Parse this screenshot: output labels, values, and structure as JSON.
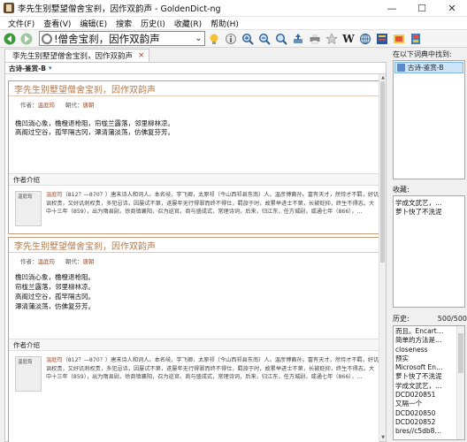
{
  "window": {
    "title": "李先生别墅望僧舍宝刹，因作双韵声 - GoldenDict-ng",
    "minimize": "—",
    "maximize": "☐",
    "close": "✕"
  },
  "menu": [
    "文件(F)",
    "查看(V)",
    "编辑(E)",
    "搜索",
    "历史(I)",
    "收藏(R)",
    "帮助(H)"
  ],
  "toolbar": {
    "search_value": "!僧舍宝刹，因作双韵声",
    "icons": [
      "back-icon",
      "forward-icon",
      "lightbulb-icon",
      "info-icon",
      "zoom-in-icon",
      "zoom-out-icon",
      "zoom-reset-icon",
      "export-icon",
      "print-icon",
      "favorite-star-icon",
      "wikipedia-icon",
      "network-icon",
      "dictionary-icon",
      "image-icon",
      "book-icon"
    ],
    "wikipedia_label": "W"
  },
  "tab": {
    "label": "李先生别墅望僧舍宝刹，因作双韵声",
    "close": "×"
  },
  "dictionary_bar": {
    "name": "古诗-鉴赏-B",
    "chevron": "▾"
  },
  "entries": [
    {
      "title": "李先生别墅望僧舍宝刹，因作双韵声",
      "author_label": "作者：",
      "author": "温庭筠",
      "dynasty_label": "朝代：",
      "dynasty": "唐朝",
      "poem_lines": [
        "檐凹淌心象，檐橙退枪阻，帘栊兰露落，邻里柳林凉。",
        "高阁过空谷，孤竿隔古冈，潭清蒲淡荡，仿佛复芬芳。"
      ],
      "section": "作者介绍",
      "image_caption": "温庭筠",
      "bio_name": "温庭筠",
      "bio_text": "（812？—870？）唐末诗人和词人。本名岐，字飞卿，太原祁（今山西祁县东南）人。温彦博裔孙。富有天才，然恃才不羁，好讥讽权贵，又好讥刺权贵，多犯忌讳，因屡试不第，遂屡年无行得罪而终不得仕，羁旅于时，故累举进士不第，长被贬抑，终生不得志。大中十三年（859），出为隋县尉。徐商镇襄阳，召为巡官。商与盛成式，常理诗词，后来，归江东，任方城尉，咸通七年（866），…"
    },
    {
      "title": "李先生别墅望僧舍宝刹，因作双韵声",
      "author_label": "作者：",
      "author": "温庭筠",
      "dynasty_label": "朝代：",
      "dynasty": "唐朝",
      "poem_lines": [
        "檐凹淌心象，檐橙退枪阻。",
        "帘栊兰露落，邻里柳林凉。",
        "高阁过空谷，孤竿隔古冈。",
        "潭清蒲淡荡，仿佛复芬芳。"
      ],
      "section": "作者介绍",
      "image_caption": "温庭筠",
      "bio_name": "温庭筠",
      "bio_text": "（812？—870？）唐末诗人和词人。本名岐，字飞卿，太原祁（今山西祁县东南）人。温彦博裔孙。富有天才，然恃才不羁，好讥讽权贵，又好讥刺权贵，多犯忌讳，因屡试不第，遂屡年无行得罪而终不得仕，羁旅于时，故累举进士不第，长被贬抑，终生不得志。大中十三年（859），出为隋县尉。徐商镇襄阳，召为巡官。商与盛成式，常理诗词，后来，归江东，任方城尉，咸通七年（866），…"
    }
  ],
  "found_in": {
    "label": "在以下词典中找到:",
    "items": [
      "古诗-鉴赏-B"
    ]
  },
  "favorites": {
    "label": "收藏:",
    "items": [
      "学成文武艺，…",
      "萝卜快了不洗泥"
    ]
  },
  "history": {
    "label": "历史:",
    "count": "500/500",
    "items": [
      "而且。Encart…",
      "简单的方法是…",
      "closeness",
      "预实",
      "Microsoft En…",
      "萝卜快了不洗泥",
      "学成文武艺，…",
      "DCD020851",
      "又隔一个",
      "DCD020850",
      "DCD020852",
      "bres//c5db8…"
    ]
  }
}
